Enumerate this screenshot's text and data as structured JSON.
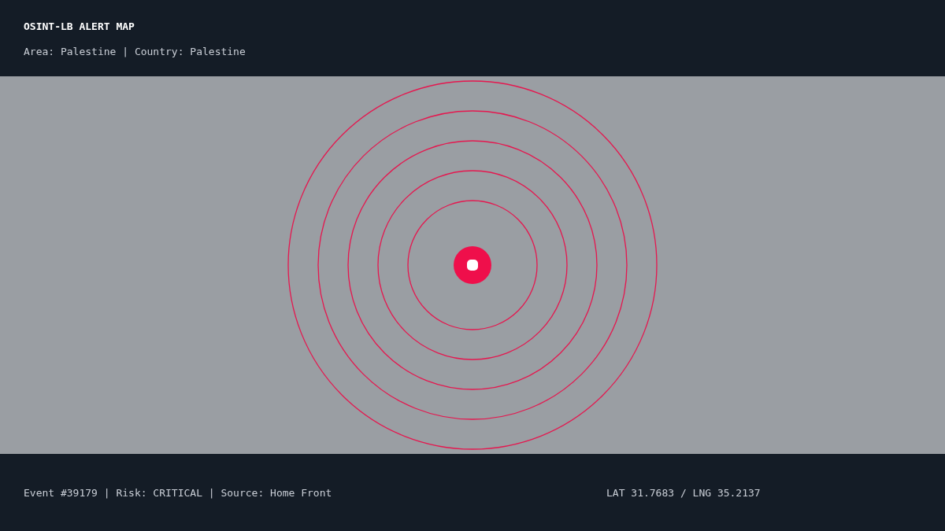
{
  "header": {
    "title": "OSINT-LB ALERT MAP",
    "subtitle": "Area: Palestine | Country: Palestine"
  },
  "footer": {
    "event": "Event #39179 | Risk: CRITICAL | Source: Home Front",
    "coordinates": "LAT 31.7683 / LNG 35.2137"
  }
}
